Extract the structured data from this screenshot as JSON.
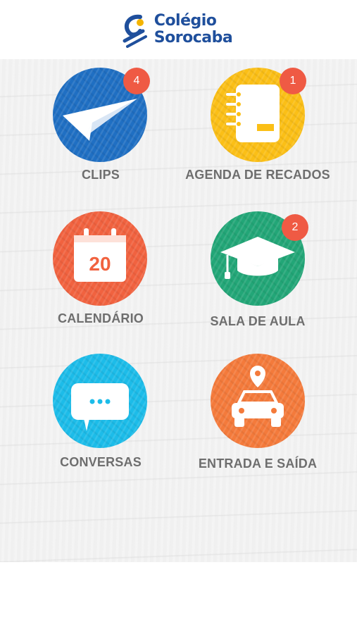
{
  "header": {
    "logo_line1": "Colégio",
    "logo_line2": "Sorocaba"
  },
  "menu": [
    {
      "label": "CLIPS",
      "badge": "4",
      "color": "#1f6fc3",
      "icon": "paper-plane-icon"
    },
    {
      "label": "AGENDA DE RECADOS",
      "badge": "1",
      "color": "#fbbf16",
      "icon": "notebook-icon"
    },
    {
      "label": "CALENDÁRIO",
      "badge": "",
      "color": "#f1623f",
      "icon": "calendar-icon"
    },
    {
      "label": "SALA DE AULA",
      "badge": "2",
      "color": "#22a677",
      "icon": "graduation-cap-icon"
    },
    {
      "label": "CONVERSAS",
      "badge": "",
      "color": "#1cbce9",
      "icon": "chat-bubble-icon"
    },
    {
      "label": "ENTRADA E SAÍDA",
      "badge": "",
      "color": "#f47a3b",
      "icon": "car-location-icon"
    }
  ],
  "calendar_day": "20",
  "colors": {
    "brand": "#1f4f9c",
    "badge": "#ef5a44",
    "label": "#6e6e6e"
  }
}
